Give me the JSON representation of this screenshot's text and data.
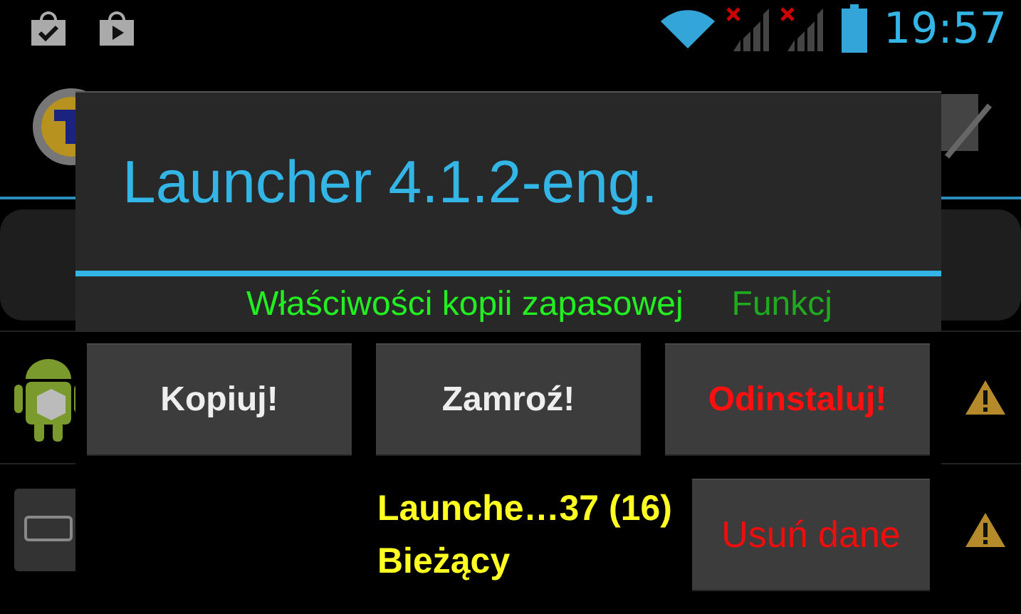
{
  "status_bar": {
    "time": "19:57"
  },
  "dialog": {
    "title": "Launcher 4.1.2-eng.",
    "tabs": [
      {
        "label": "Właściwości kopii zapasowej",
        "selected": true
      },
      {
        "label": "Funkcj",
        "selected": false
      }
    ],
    "actions": [
      {
        "label": "Kopiuj!",
        "danger": false
      },
      {
        "label": "Zamroź!",
        "danger": false
      },
      {
        "label": "Odinstaluj!",
        "danger": true
      }
    ],
    "info_lines": [
      "Launche…37 (16)",
      "Bieżący"
    ],
    "clear_data_button": {
      "label": "Usuń dane"
    }
  }
}
